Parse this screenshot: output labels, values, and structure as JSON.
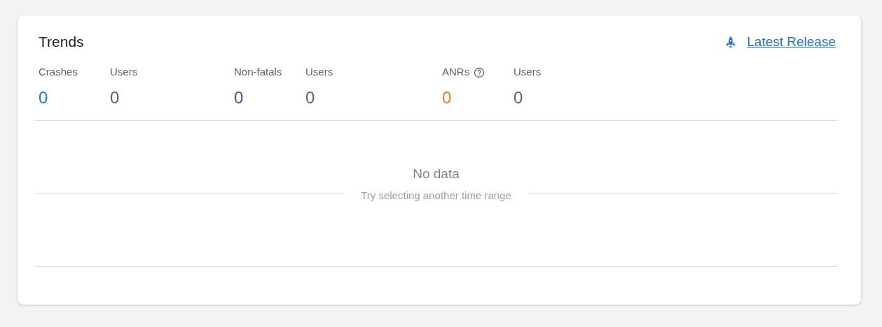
{
  "card": {
    "title": "Trends",
    "link": {
      "label": "Latest Release"
    }
  },
  "metric_groups": [
    {
      "metric": {
        "label": "Crashes",
        "value": "0",
        "color": "#1a73e8",
        "help": false
      },
      "users": {
        "label": "Users",
        "value": "0"
      }
    },
    {
      "metric": {
        "label": "Non-fatals",
        "value": "0",
        "color": "#673ab7",
        "help": false
      },
      "users": {
        "label": "Users",
        "value": "0"
      }
    },
    {
      "metric": {
        "label": "ANRs",
        "value": "0",
        "color": "#fa7b17",
        "help": true
      },
      "users": {
        "label": "Users",
        "value": "0"
      }
    }
  ],
  "empty_state": {
    "title": "No data",
    "hint": "Try selecting another time range"
  }
}
